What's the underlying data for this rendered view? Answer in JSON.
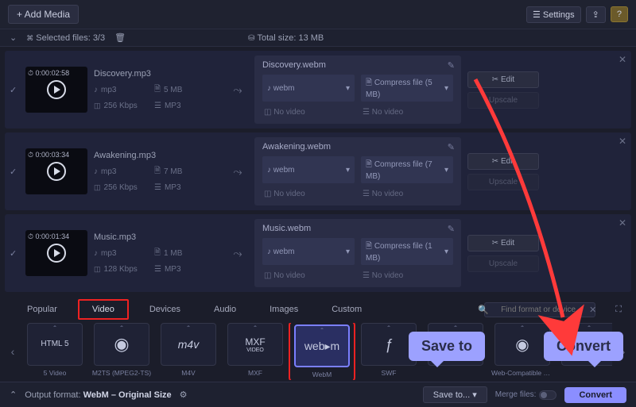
{
  "top": {
    "addMedia": "+ Add Media",
    "settings": "Settings",
    "share": "↗",
    "help": "?"
  },
  "toolbar": {
    "selected": "Selected files: 3/3",
    "totalSize": "Total size: 13 MB"
  },
  "rows": [
    {
      "duration": "0:00:02:58",
      "name": "Discovery.mp3",
      "format": "mp3",
      "size": "5 MB",
      "bitrate": "256 Kbps",
      "codec": "MP3",
      "outName": "Discovery.webm",
      "outFormat": "webm",
      "compress": "Compress file (5 MB)",
      "noVideo1": "No video",
      "noVideo2": "No video",
      "edit": "Edit",
      "upscale": "Upscale"
    },
    {
      "duration": "0:00:03:34",
      "name": "Awakening.mp3",
      "format": "mp3",
      "size": "7 MB",
      "bitrate": "256 Kbps",
      "codec": "MP3",
      "outName": "Awakening.webm",
      "outFormat": "webm",
      "compress": "Compress file (7 MB)",
      "noVideo1": "No video",
      "noVideo2": "No video",
      "edit": "Edit",
      "upscale": "Upscale"
    },
    {
      "duration": "0:00:01:34",
      "name": "Music.mp3",
      "format": "mp3",
      "size": "1 MB",
      "bitrate": "128 Kbps",
      "codec": "MP3",
      "outName": "Music.webm",
      "outFormat": "webm",
      "compress": "Compress file (1 MB)",
      "noVideo1": "No video",
      "noVideo2": "No video",
      "edit": "Edit",
      "upscale": "Upscale"
    }
  ],
  "tabs": {
    "popular": "Popular",
    "video": "Video",
    "devices": "Devices",
    "audio": "Audio",
    "images": "Images",
    "custom": "Custom",
    "searchPlaceholder": "Find format or device"
  },
  "formats": [
    {
      "id": "html5",
      "icon": "HTML\n5",
      "label": "5 Video"
    },
    {
      "id": "m2ts",
      "icon": "◔",
      "label": "M2TS (MPEG2-TS)"
    },
    {
      "id": "m4v",
      "icon": "m4v",
      "label": "M4V"
    },
    {
      "id": "mxf",
      "icon": "MXF",
      "label": "MXF"
    },
    {
      "id": "webm",
      "icon": "web▸m",
      "label": "WebM",
      "selected": true
    },
    {
      "id": "swf",
      "icon": "⚡",
      "label": "SWF"
    },
    {
      "id": "fish",
      "icon": "🐟",
      "label": ""
    },
    {
      "id": "webcam",
      "icon": "◉",
      "label": "Web-Compatible Video"
    },
    {
      "id": "film",
      "icon": "▦",
      "label": ""
    }
  ],
  "bottom": {
    "outputLabel": "Output format:",
    "outputValue": "WebM – Original Size",
    "saveTo": "Save to...",
    "merge": "Merge files:",
    "convert": "Convert"
  },
  "callouts": {
    "saveTo": "Save to",
    "convert": "Convert"
  }
}
